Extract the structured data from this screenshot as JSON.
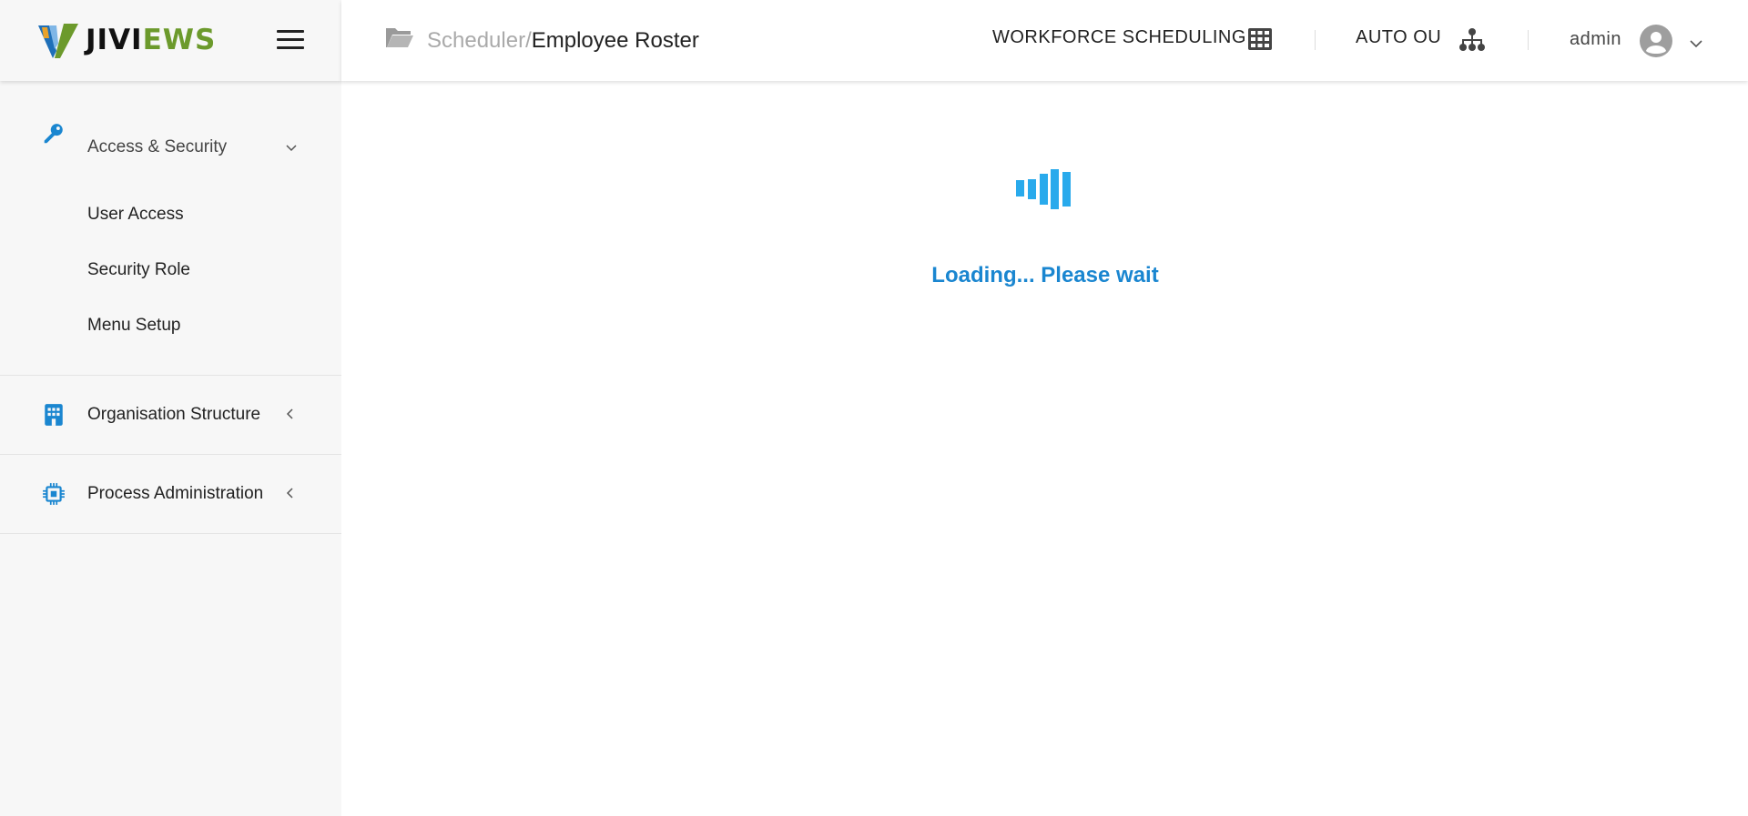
{
  "brand": {
    "name_part1": "JIVI",
    "name_part2": "EWS"
  },
  "sidebar": {
    "sections": [
      {
        "label": "Access & Security",
        "icon": "key-icon",
        "expanded": true,
        "items": [
          {
            "label": "User Access"
          },
          {
            "label": "Security Role"
          },
          {
            "label": "Menu Setup"
          }
        ]
      },
      {
        "label": "Organisation Structure",
        "icon": "building-icon",
        "expanded": false
      },
      {
        "label": "Process Administration",
        "icon": "chip-icon",
        "expanded": false
      }
    ]
  },
  "header": {
    "breadcrumb": {
      "parent": "Scheduler",
      "separator": "/",
      "current": "Employee Roster"
    },
    "module": "WORKFORCE SCHEDULING",
    "org_unit": "AUTO OU",
    "user": "admin"
  },
  "main": {
    "loading_text": "Loading... Please wait"
  },
  "colors": {
    "accent": "#1a86d0",
    "loader": "#29aaec",
    "brand_green": "#6c9a2c"
  }
}
